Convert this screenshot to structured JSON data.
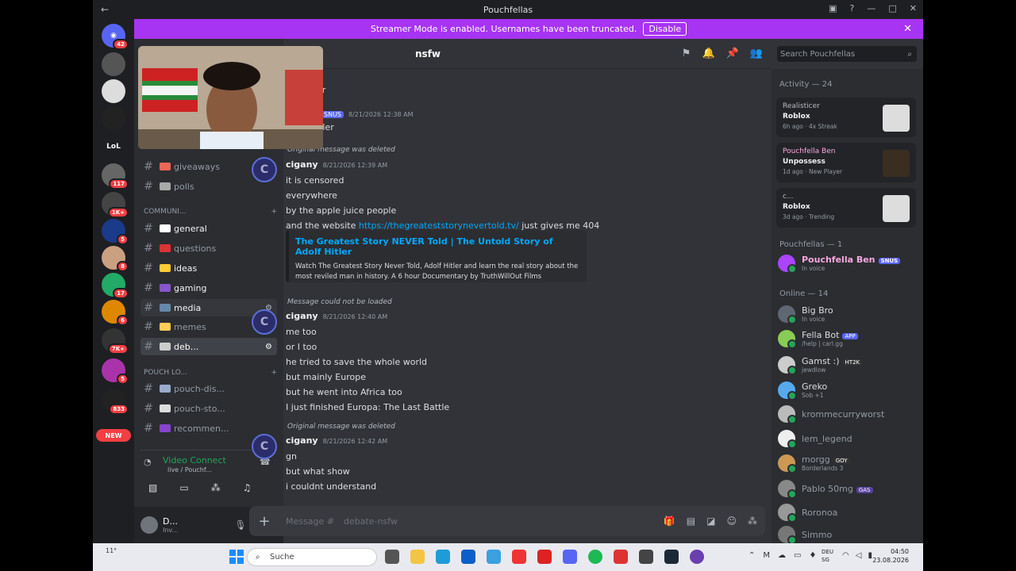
{
  "window": {
    "title": "Pouchfellas"
  },
  "banner": {
    "text": "Streamer Mode is enabled. Usernames have been truncated.",
    "button": "Disable"
  },
  "servers": {
    "badges": [
      "42",
      "117",
      "1K+",
      "5",
      "8",
      "17",
      "6",
      "7K+",
      "5",
      "833"
    ],
    "labels": [
      "LoL"
    ],
    "new_label": "NEW"
  },
  "channels": {
    "items": [
      {
        "label": "giveaways"
      },
      {
        "label": "polls"
      }
    ],
    "category1": "COMMUNI...",
    "items2": [
      {
        "label": "general"
      },
      {
        "label": "questions"
      },
      {
        "label": "ideas"
      },
      {
        "label": "gaming"
      },
      {
        "label": "media"
      },
      {
        "label": "memes"
      },
      {
        "label": "deb..."
      }
    ],
    "category2": "POUCH LO...",
    "items3": [
      {
        "label": "pouch-dis..."
      },
      {
        "label": "pouch-sto..."
      },
      {
        "label": "recommen..."
      }
    ]
  },
  "voice": {
    "status": "Video Connect",
    "sub": "live / Pouchf..."
  },
  "user": {
    "name": "D...",
    "status": "Inv..."
  },
  "header": {
    "channel": "nsfw"
  },
  "search": {
    "placeholder": "Search Pouchfellas"
  },
  "messages": {
    "top_fragments": [
      "er",
      "itler"
    ],
    "top_tag": "SNUS",
    "top_time": "8/21/2026 12:38 AM",
    "m1": {
      "reply": "Original message was deleted",
      "user": "cigany",
      "time": "8/21/2026 12:39 AM",
      "lines": [
        "it is censored",
        "everywhere",
        "by the apple juice people"
      ],
      "last_prefix": "and the website ",
      "link": "https://thegreateststorynevertold.tv/",
      "last_suffix": " just gives me 404"
    },
    "embed": {
      "title": "The Greatest Story NEVER Told | The Untold Story of Adolf Hitler",
      "desc": "Watch The Greatest Story Never Told, Adolf Hitler and learn the real story about the most reviled man in history. A 6 hour Documentary by TruthWillOut Films"
    },
    "m2": {
      "reply": "Message could not be loaded",
      "user": "cigany",
      "time": "8/21/2026 12:40 AM",
      "lines": [
        "me too",
        "or I too",
        "he tried to save the whole world",
        "but mainly Europe",
        "but he went into Africa too",
        "I just finished Europa: The Last Battle"
      ]
    },
    "m3": {
      "reply": "Original message was deleted",
      "user": "cigany",
      "time": "8/21/2026 12:42 AM",
      "lines": [
        "gn",
        "but what show",
        "i couldnt understand"
      ]
    }
  },
  "composer": {
    "placeholder": "Message #",
    "channel": "debate-nsfw"
  },
  "members": {
    "activity_header": "Activity — 24",
    "activities": [
      {
        "user": "Realisticer",
        "game": "Roblox",
        "meta": "6h ago",
        "extra": "4x Streak"
      },
      {
        "user": "Pouchfella Ben",
        "game": "Unpossess",
        "meta": "1d ago",
        "extra": "New Player"
      },
      {
        "user": "c...",
        "game": "Roblox",
        "meta": "3d ago",
        "extra": "Trending"
      }
    ],
    "group1": "Pouchfellas — 1",
    "owner": {
      "name": "Pouchfella Ben",
      "tag": "SNUS",
      "sub": "In voice"
    },
    "group2": "Online — 14",
    "list": [
      {
        "name": "Big Bro",
        "sub": "In voice",
        "tag": ""
      },
      {
        "name": "Fella Bot",
        "sub": "/help | carl.gg",
        "tag": "APP"
      },
      {
        "name": "Gamst :)",
        "sub": "jewdlow",
        "tag": "HT2K"
      },
      {
        "name": "Greko",
        "sub": "Sob +1",
        "tag": ""
      },
      {
        "name": "krommecurryworst",
        "sub": "",
        "tag": ""
      },
      {
        "name": "lem_legend",
        "sub": "",
        "tag": ""
      },
      {
        "name": "morgg",
        "sub": "Borderlands 3",
        "tag": "GOY"
      },
      {
        "name": "Pablo 50mg",
        "sub": "",
        "tag": "GAS"
      },
      {
        "name": "Roronoa",
        "sub": "",
        "tag": ""
      },
      {
        "name": "Simmo",
        "sub": "",
        "tag": ""
      }
    ]
  },
  "taskbar": {
    "search": "Suche",
    "weather": "11°",
    "lang1": "DEU",
    "lang2": "SG",
    "time": "04:50",
    "date": "23.08.2026"
  },
  "colors": {
    "accent": "#5865f2",
    "banner": "#a734f2",
    "link": "#00a8fc",
    "online": "#23a55a"
  }
}
